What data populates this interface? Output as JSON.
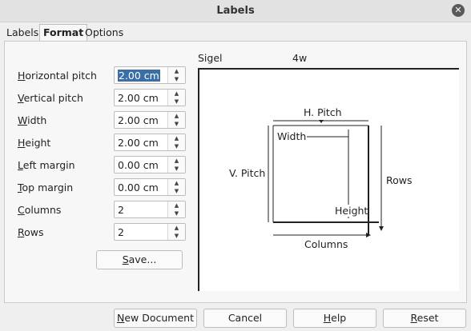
{
  "window": {
    "title": "Labels"
  },
  "tabs": [
    {
      "label": "Labels"
    },
    {
      "label": "Format"
    },
    {
      "label": "Options"
    }
  ],
  "fields": [
    {
      "key": "H",
      "rest": "orizontal pitch",
      "value": "2.00 cm"
    },
    {
      "key": "V",
      "rest": "ertical pitch",
      "value": "2.00 cm"
    },
    {
      "key": "W",
      "rest": "idth",
      "value": "2.00 cm"
    },
    {
      "key": "H",
      "rest": "eight",
      "value": "2.00 cm"
    },
    {
      "key": "L",
      "rest": "eft margin",
      "value": "0.00 cm"
    },
    {
      "key": "T",
      "rest": "op margin",
      "value": "0.00 cm"
    },
    {
      "key": "C",
      "rest": "olumns",
      "value": "2"
    },
    {
      "key": "R",
      "rest": "ows",
      "value": "2"
    }
  ],
  "save_button": {
    "key": "S",
    "rest": "ave..."
  },
  "preview": {
    "brand": "Sigel",
    "type": "4w",
    "h_pitch": "H. Pitch",
    "width": "Width",
    "v_pitch": "V. Pitch",
    "rows": "Rows",
    "height": "Height",
    "columns": "Columns"
  },
  "buttons": {
    "new_document": {
      "key": "N",
      "rest": "ew Document"
    },
    "cancel": {
      "label": "Cancel"
    },
    "help": {
      "key": "H",
      "rest": "elp"
    },
    "reset": {
      "key": "R",
      "rest": "eset"
    }
  }
}
